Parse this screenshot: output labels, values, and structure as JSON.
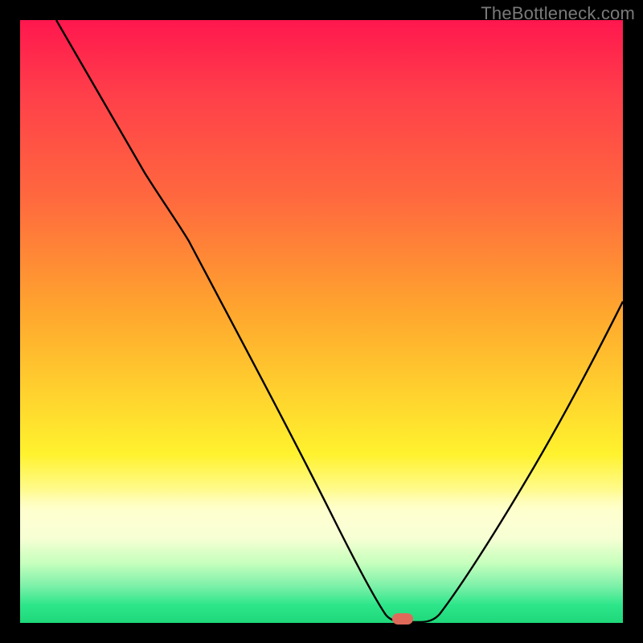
{
  "watermark": "TheBottleneck.com",
  "colors": {
    "frame": "#000000",
    "curve": "#000000",
    "marker": "#e06a5a"
  },
  "chart_data": {
    "type": "line",
    "title": "",
    "xlabel": "",
    "ylabel": "",
    "xlim": [
      0,
      100
    ],
    "ylim": [
      0,
      100
    ],
    "background_gradient_stops": [
      {
        "pos": 0,
        "color": "#ff174e"
      },
      {
        "pos": 30,
        "color": "#ff6a3e"
      },
      {
        "pos": 62,
        "color": "#ffd22e"
      },
      {
        "pos": 81,
        "color": "#ffffbe"
      },
      {
        "pos": 94,
        "color": "#7af0a8"
      },
      {
        "pos": 100,
        "color": "#1ed87a"
      }
    ],
    "series": [
      {
        "name": "bottleneck-curve",
        "x": [
          6,
          12,
          20,
          27,
          40,
          50,
          56,
          60,
          63,
          68,
          75,
          82,
          90,
          100
        ],
        "y": [
          100,
          90,
          78,
          68,
          44,
          24,
          9,
          1,
          0,
          1,
          10,
          24,
          42,
          64
        ]
      }
    ],
    "marker": {
      "x": 63,
      "y": 0.5,
      "shape": "pill"
    },
    "notes": "y is percentage height from bottom (0 = bottom green line, 100 = top). Values estimated from pixel positions."
  }
}
